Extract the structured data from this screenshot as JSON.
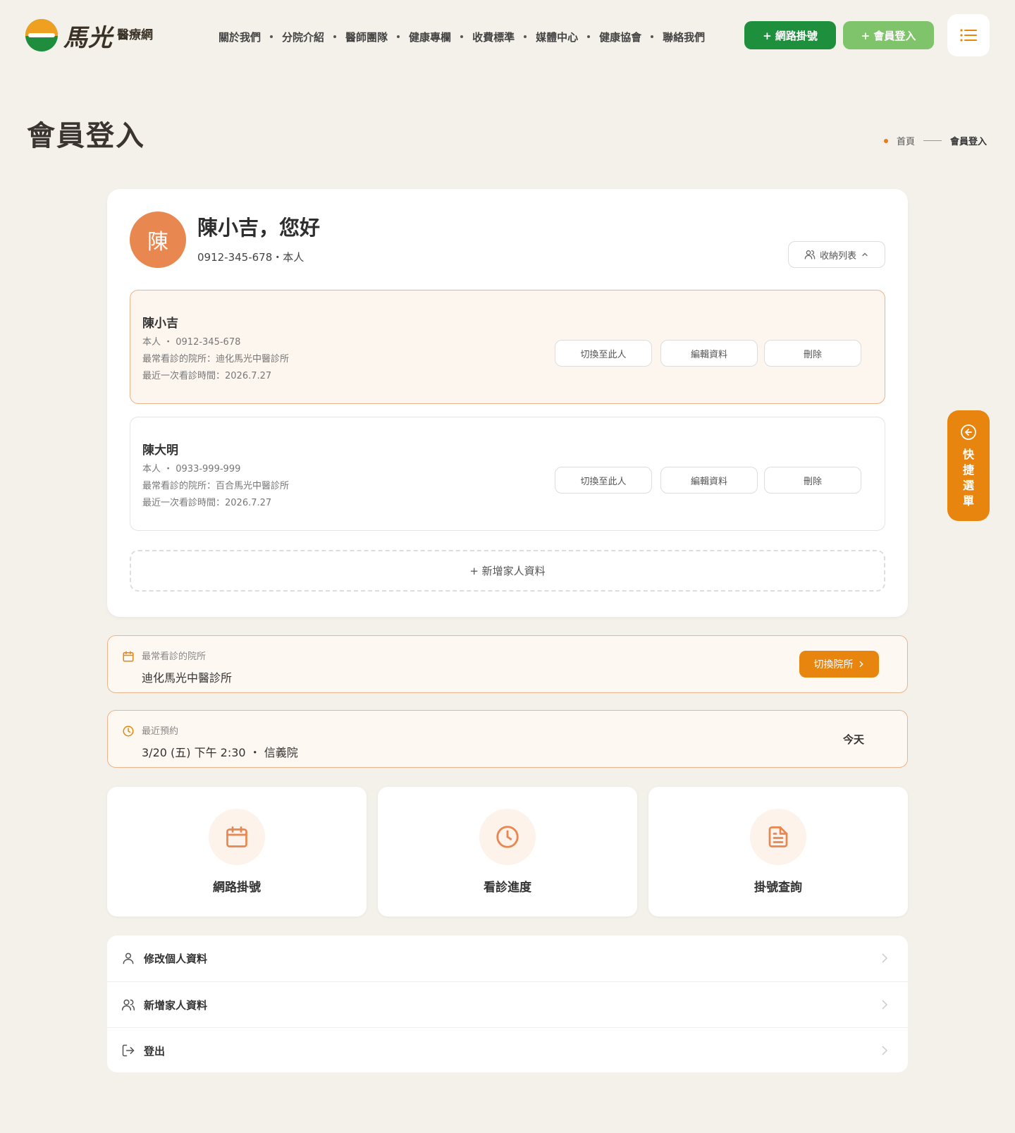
{
  "header": {
    "logo_text": "馬光",
    "logo_sub": "醫療網",
    "nav": [
      "關於我們",
      "分院介紹",
      "醫師團隊",
      "健康專欄",
      "收費標準",
      "媒體中心",
      "健康協會",
      "聯絡我們"
    ],
    "register_button": "+ 網路掛號",
    "login_button": "+ 會員登入",
    "menu_icon": "list-icon",
    "colors": {
      "register": "#1e8f3d",
      "login": "#7fc46a",
      "accent": "#e8850f"
    }
  },
  "page": {
    "title": "會員登入",
    "breadcrumb": {
      "home": "首頁",
      "current": "會員登入"
    }
  },
  "profile": {
    "avatar_char": "陳",
    "greeting": "陳小吉，您好",
    "phone_line": "0912-345-678・本人",
    "collapse_button": "收納列表"
  },
  "members": [
    {
      "name": "陳小吉",
      "relation_phone": "本人 ・ 0912-345-678",
      "clinic": "最常看診的院所：迪化馬光中醫診所",
      "last_visit": "最近一次看診時間：2026.7.27",
      "switch": "切換至此人",
      "edit": "編輯資料",
      "delete": "刪除"
    },
    {
      "name": "陳大明",
      "relation_phone": "本人 ・ 0933-999-999",
      "clinic": "最常看診的院所：百合馬光中醫診所",
      "last_visit": "最近一次看診時間：2026.7.27",
      "switch": "切換至此人",
      "edit": "編輯資料",
      "delete": "刪除"
    }
  ],
  "add_family": "+ 新增家人資料",
  "frequent_clinic": {
    "label": "最常看診的院所",
    "value": "迪化馬光中醫診所",
    "button": "切換院所"
  },
  "recent_booking": {
    "label": "最近預約",
    "value": "3/20 (五) 下午 2:30 ・ 信義院",
    "badge": "今天"
  },
  "tiles": [
    {
      "label": "網路掛號",
      "icon": "calendar-icon"
    },
    {
      "label": "看診進度",
      "icon": "clock-icon"
    },
    {
      "label": "掛號查詢",
      "icon": "document-icon"
    }
  ],
  "menu_list": [
    {
      "label": "修改個人資料",
      "icon": "user-icon"
    },
    {
      "label": "新增家人資料",
      "icon": "users-icon"
    },
    {
      "label": "登出",
      "icon": "logout-icon"
    }
  ],
  "quick_menu": {
    "label": [
      "快",
      "捷",
      "選",
      "單"
    ],
    "icon": "arrow-left-circle-icon"
  }
}
